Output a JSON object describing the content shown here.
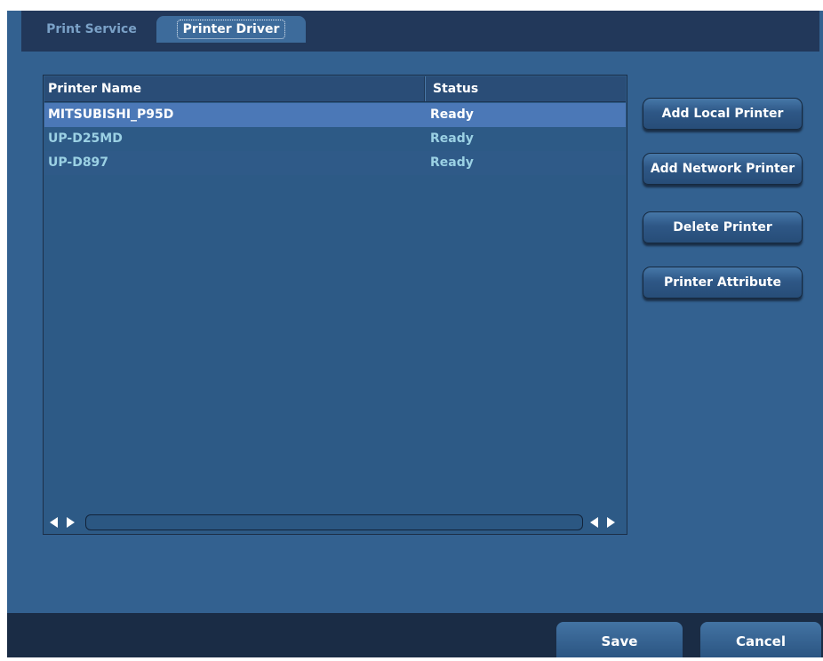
{
  "tabs": {
    "print_service": "Print Service",
    "printer_driver": "Printer Driver"
  },
  "table": {
    "columns": {
      "name": "Printer Name",
      "status": "Status"
    },
    "rows": [
      {
        "name": "MITSUBISHI_P95D",
        "status": "Ready"
      },
      {
        "name": "UP-D25MD",
        "status": "Ready"
      },
      {
        "name": "UP-D897",
        "status": "Ready"
      }
    ]
  },
  "buttons": {
    "add_local": "Add Local Printer",
    "add_network": "Add Network Printer",
    "delete": "Delete Printer",
    "attribute": "Printer Attribute"
  },
  "footer": {
    "save": "Save",
    "cancel": "Cancel"
  },
  "colors": {
    "window_bg": "#336190",
    "tab_strip": "#22385a",
    "selected_row": "#4b78b7",
    "row_text": "#9bd1e4",
    "footer_bg": "#1a2c45"
  }
}
